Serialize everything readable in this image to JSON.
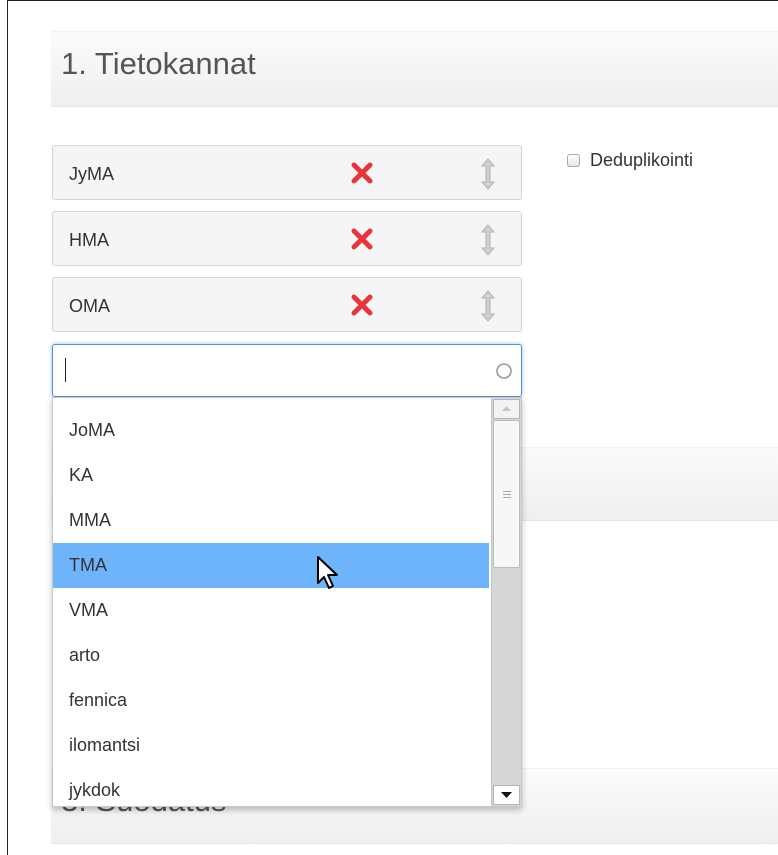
{
  "sections": {
    "databases_title": "1. Tietokannat",
    "filter_title": "3. Suodatus"
  },
  "selected_databases": [
    {
      "label": "JyMA",
      "remove_icon": "remove-x-icon",
      "drag_icon": "drag-handle-icon"
    },
    {
      "label": "HMA",
      "remove_icon": "remove-x-icon",
      "drag_icon": "drag-handle-icon"
    },
    {
      "label": "OMA",
      "remove_icon": "remove-x-icon",
      "drag_icon": "drag-handle-icon"
    }
  ],
  "deduplication": {
    "label": "Deduplikointi",
    "checked": false
  },
  "search": {
    "value": "",
    "placeholder": "",
    "icon": "spinner-icon"
  },
  "dropdown": {
    "options": [
      "JoMA",
      "KA",
      "MMA",
      "TMA",
      "VMA",
      "arto",
      "fennica",
      "ilomantsi",
      "jykdok"
    ],
    "highlighted": "TMA"
  },
  "colors": {
    "highlight": "#6eb4fb",
    "remove": "#e8343a",
    "focus_border": "#5b8dd6"
  }
}
